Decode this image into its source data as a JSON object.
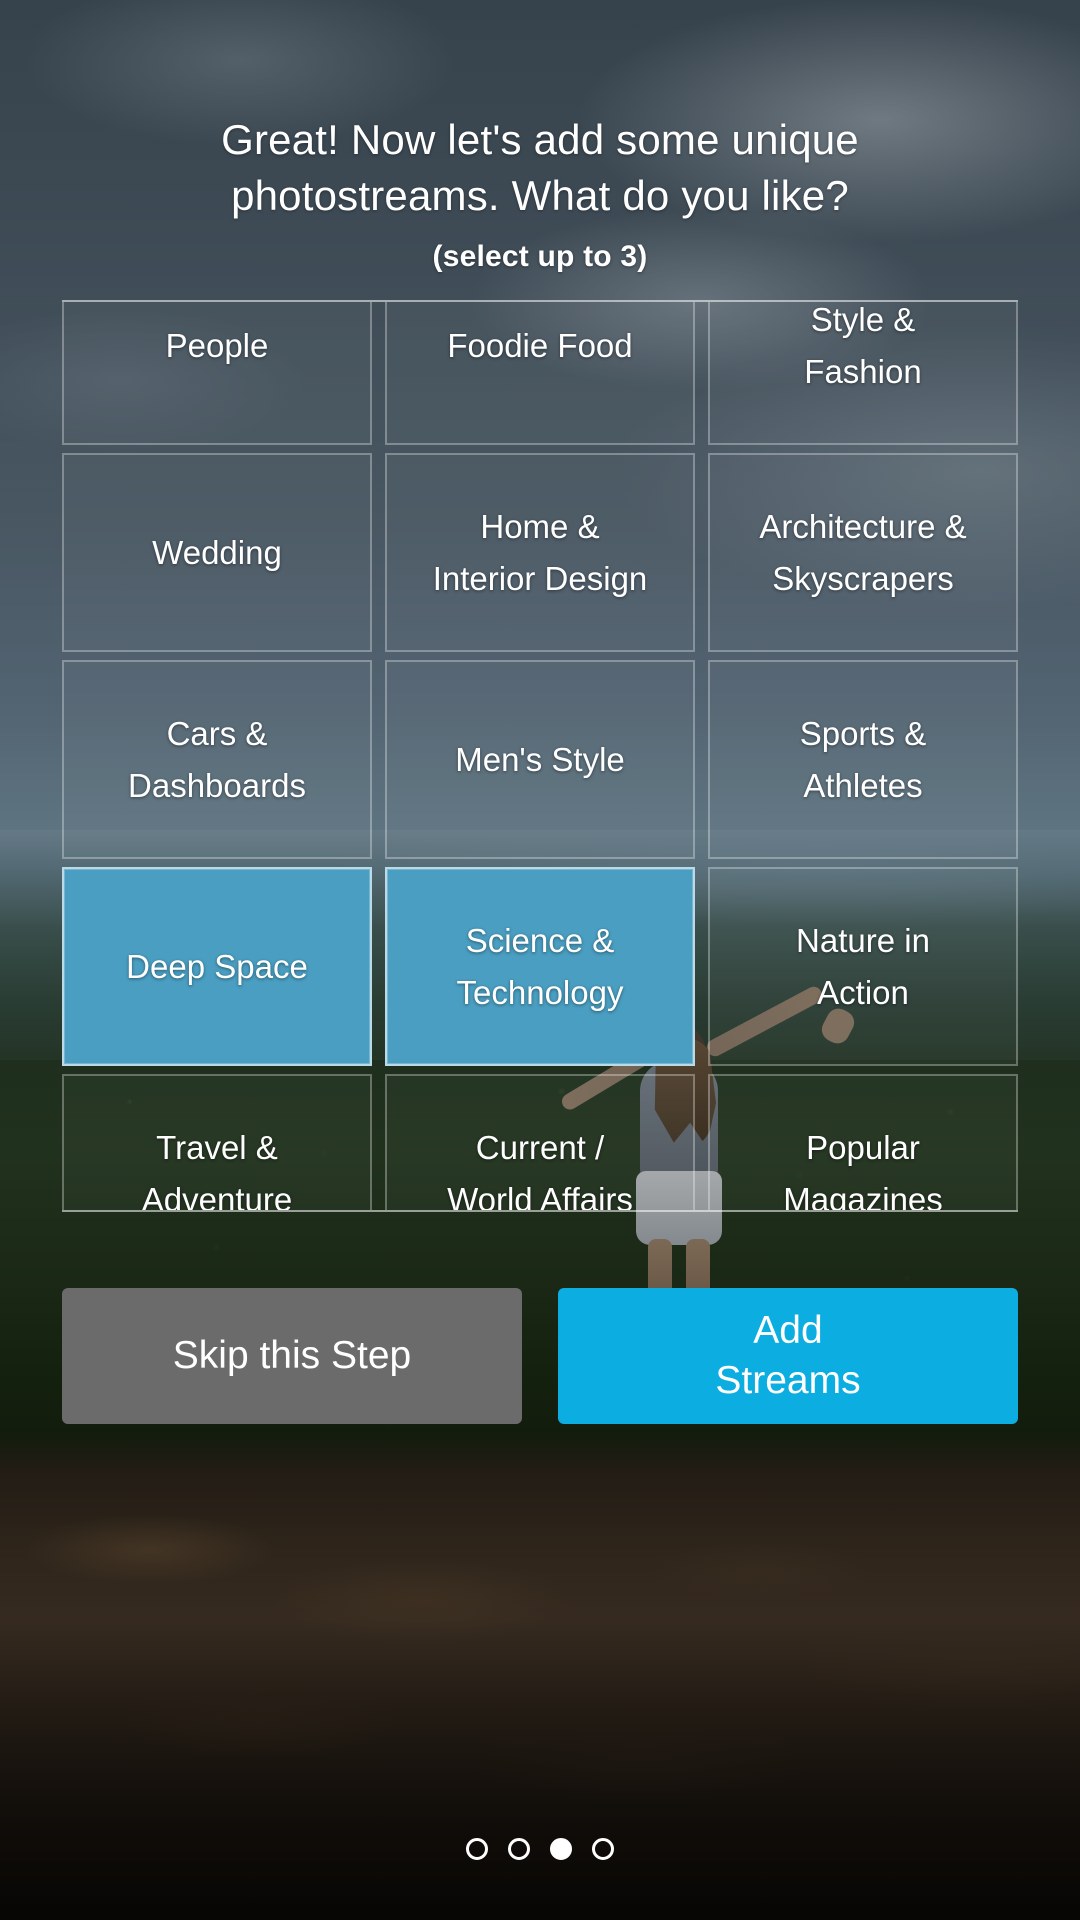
{
  "headline": "Great! Now let's add some unique photostreams. What do you like?",
  "subline": "(select up to 3)",
  "grid": {
    "tiles": [
      {
        "label": "People",
        "selected": false
      },
      {
        "label": "Foodie Food",
        "selected": false
      },
      {
        "label": "Style &\nFashion",
        "selected": false
      },
      {
        "label": "Wedding",
        "selected": false
      },
      {
        "label": "Home &\nInterior Design",
        "selected": false
      },
      {
        "label": "Architecture &\nSkyscrapers",
        "selected": false
      },
      {
        "label": "Cars &\nDashboards",
        "selected": false
      },
      {
        "label": "Men's Style",
        "selected": false
      },
      {
        "label": "Sports &\nAthletes",
        "selected": false
      },
      {
        "label": "Deep Space",
        "selected": true
      },
      {
        "label": "Science &\nTechnology",
        "selected": true
      },
      {
        "label": "Nature in\nAction",
        "selected": false
      },
      {
        "label": "Travel &\nAdventure",
        "selected": false
      },
      {
        "label": "Current /\nWorld Affairs",
        "selected": false
      },
      {
        "label": "Popular\nMagazines",
        "selected": false
      }
    ]
  },
  "actions": {
    "skip_label": "Skip this Step",
    "add_label": "Add\nStreams"
  },
  "pager": {
    "total": 4,
    "active_index": 2
  },
  "colors": {
    "selected_tile": "#4a9ec1",
    "primary_button": "#0cade0",
    "secondary_button": "#6b6b6b",
    "text": "#ffffff"
  }
}
